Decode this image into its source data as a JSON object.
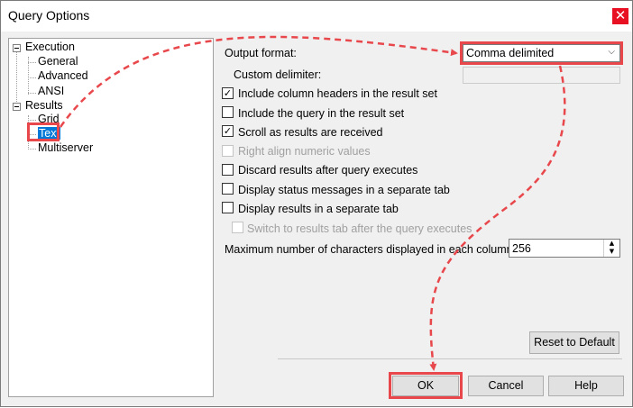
{
  "window": {
    "title": "Query Options",
    "close_glyph": "✕"
  },
  "tree": {
    "groups": [
      {
        "label": "Execution",
        "children": [
          "General",
          "Advanced",
          "ANSI"
        ]
      },
      {
        "label": "Results",
        "children": [
          "Grid",
          "Text",
          "Multiserver"
        ]
      }
    ],
    "selected": "Text"
  },
  "options": {
    "output_format_label": "Output format:",
    "output_format_value": "Comma delimited",
    "custom_delimiter_label": "Custom delimiter:",
    "checkboxes": [
      {
        "label": "Include column headers in the result set",
        "checked": true,
        "enabled": true
      },
      {
        "label": "Include the query in the result set",
        "checked": false,
        "enabled": true
      },
      {
        "label": "Scroll as results are received",
        "checked": true,
        "enabled": true
      },
      {
        "label": "Right align numeric values",
        "checked": false,
        "enabled": false
      },
      {
        "label": "Discard results after query executes",
        "checked": false,
        "enabled": true
      },
      {
        "label": "Display status messages in a separate tab",
        "checked": false,
        "enabled": true
      },
      {
        "label": "Display results in a separate tab",
        "checked": false,
        "enabled": true
      },
      {
        "label": "Switch to results tab after the query executes",
        "checked": false,
        "enabled": false
      }
    ],
    "max_chars_label": "Maximum number of characters displayed in each column:",
    "max_chars_value": "256"
  },
  "buttons": {
    "reset": "Reset to Default",
    "ok": "OK",
    "cancel": "Cancel",
    "help": "Help"
  },
  "icons": {
    "check": "✓",
    "chevron": "⌵",
    "spin_up": "▲",
    "spin_down": "▼"
  },
  "colors": {
    "highlight": "#e8484c",
    "selection": "#0078d7",
    "close_button": "#e81123"
  }
}
